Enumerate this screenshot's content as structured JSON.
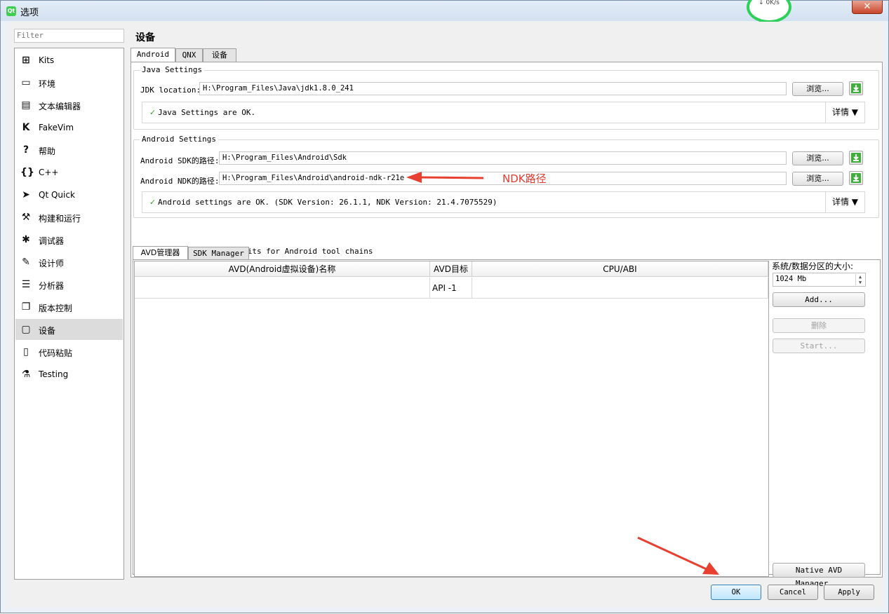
{
  "window": {
    "title": "选项",
    "app_icon": "Qt",
    "close": "✕"
  },
  "net_widget": {
    "percent": "✕ %",
    "speed": "↓  0K/s"
  },
  "filter": {
    "placeholder": "Filter"
  },
  "nav": {
    "items": [
      {
        "label": "Kits",
        "icon": "kits-icon",
        "glyph": "⊞"
      },
      {
        "label": "环境",
        "icon": "monitor-icon",
        "glyph": "▭"
      },
      {
        "label": "文本编辑器",
        "icon": "text-editor-icon",
        "glyph": "▤"
      },
      {
        "label": "FakeVim",
        "icon": "fakevim-icon",
        "glyph": "K"
      },
      {
        "label": "帮助",
        "icon": "help-icon",
        "glyph": "?"
      },
      {
        "label": "C++",
        "icon": "braces-icon",
        "glyph": "{}"
      },
      {
        "label": "Qt Quick",
        "icon": "qt-quick-icon",
        "glyph": "➤"
      },
      {
        "label": "构建和运行",
        "icon": "hammer-icon",
        "glyph": "⚒"
      },
      {
        "label": "调试器",
        "icon": "bug-icon",
        "glyph": "✱"
      },
      {
        "label": "设计师",
        "icon": "pencil-icon",
        "glyph": "✎"
      },
      {
        "label": "分析器",
        "icon": "analyzer-icon",
        "glyph": "☰"
      },
      {
        "label": "版本控制",
        "icon": "version-control-icon",
        "glyph": "❐"
      },
      {
        "label": "设备",
        "icon": "devices-icon",
        "glyph": "▢"
      },
      {
        "label": "代码粘贴",
        "icon": "clipboard-icon",
        "glyph": "▯"
      },
      {
        "label": "Testing",
        "icon": "testing-icon",
        "glyph": "⚗"
      }
    ],
    "selected": "设备"
  },
  "page": {
    "title": "设备",
    "tabs": [
      "Android",
      "QNX",
      "设备"
    ],
    "java": {
      "title": "Java Settings",
      "jdk_label": "JDK location:",
      "jdk_path": "H:\\Program_Files\\Java\\jdk1.8.0_241",
      "browse": "浏览...",
      "status": "Java Settings are OK.",
      "details": "详情 ▼"
    },
    "android": {
      "title": "Android Settings",
      "sdk_label": "Android SDK的路径:",
      "sdk_path": "H:\\Program_Files\\Android\\Sdk",
      "ndk_label": "Android NDK的路径:",
      "ndk_path": "H:\\Program_Files\\Android\\android-ndk-r21e",
      "browse": "浏览...",
      "status": "Android settings are OK.  (SDK Version: 26.1.1, NDK Version: 21.4.7075529)",
      "details": "详情 ▼"
    },
    "auto_kits": {
      "label": "Automatically create kits for Android tool chains",
      "checked": true
    },
    "avd": {
      "tabs": [
        "AVD管理器",
        "SDK Manager"
      ],
      "columns": [
        "AVD(Android虚拟设备)名称",
        "AVD目标",
        "CPU/ABI"
      ],
      "rows": [
        {
          "name": "",
          "target": "API -1",
          "abi": ""
        }
      ],
      "partition_label": "系统/数据分区的大小:",
      "partition_value": "1024 Mb",
      "add": "Add...",
      "delete": "删除",
      "start": "Start...",
      "native_manager": "Native AVD Manager..."
    }
  },
  "annotation": {
    "text": "NDK路径",
    "color": "#e03a2e"
  },
  "dialog_buttons": {
    "ok": "OK",
    "cancel": "Cancel",
    "apply": "Apply"
  }
}
